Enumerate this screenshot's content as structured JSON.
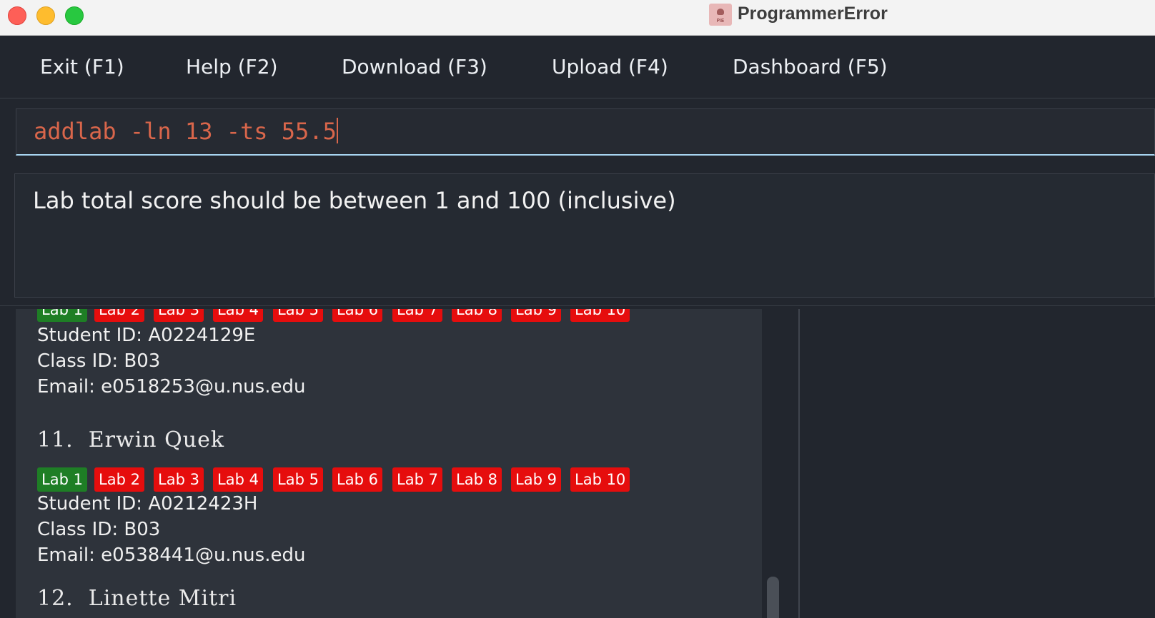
{
  "window": {
    "title": "ProgrammerError"
  },
  "menu": {
    "items": [
      {
        "label": "Exit (F1)"
      },
      {
        "label": "Help (F2)"
      },
      {
        "label": "Download (F3)"
      },
      {
        "label": "Upload (F4)"
      },
      {
        "label": "Dashboard (F5)"
      }
    ]
  },
  "command": {
    "value": "addlab -ln 13 -ts 55.5"
  },
  "result": {
    "text": "Lab total score should be between 1 and 100 (inclusive)"
  },
  "labs": [
    "Lab 1",
    "Lab 2",
    "Lab 3",
    "Lab 4",
    "Lab 5",
    "Lab 6",
    "Lab 7",
    "Lab 8",
    "Lab 9",
    "Lab 10"
  ],
  "students": [
    {
      "lab_status": [
        "done",
        "todo",
        "todo",
        "todo",
        "todo",
        "todo",
        "todo",
        "todo",
        "todo",
        "todo"
      ],
      "student_id": "Student ID: A0224129E",
      "class_id": "Class ID: B03",
      "email": "Email: e0518253@u.nus.edu"
    },
    {
      "heading": "11.  Erwin Quek",
      "lab_status": [
        "done",
        "todo",
        "todo",
        "todo",
        "todo",
        "todo",
        "todo",
        "todo",
        "todo",
        "todo"
      ],
      "student_id": "Student ID: A0212423H",
      "class_id": "Class ID: B03",
      "email": "Email: e0538441@u.nus.edu"
    },
    {
      "heading": "12.  Linette Mitri"
    }
  ],
  "colors": {
    "lab_done": "#1e7e25",
    "lab_todo": "#e60d0d",
    "command_text": "#d9664b"
  }
}
